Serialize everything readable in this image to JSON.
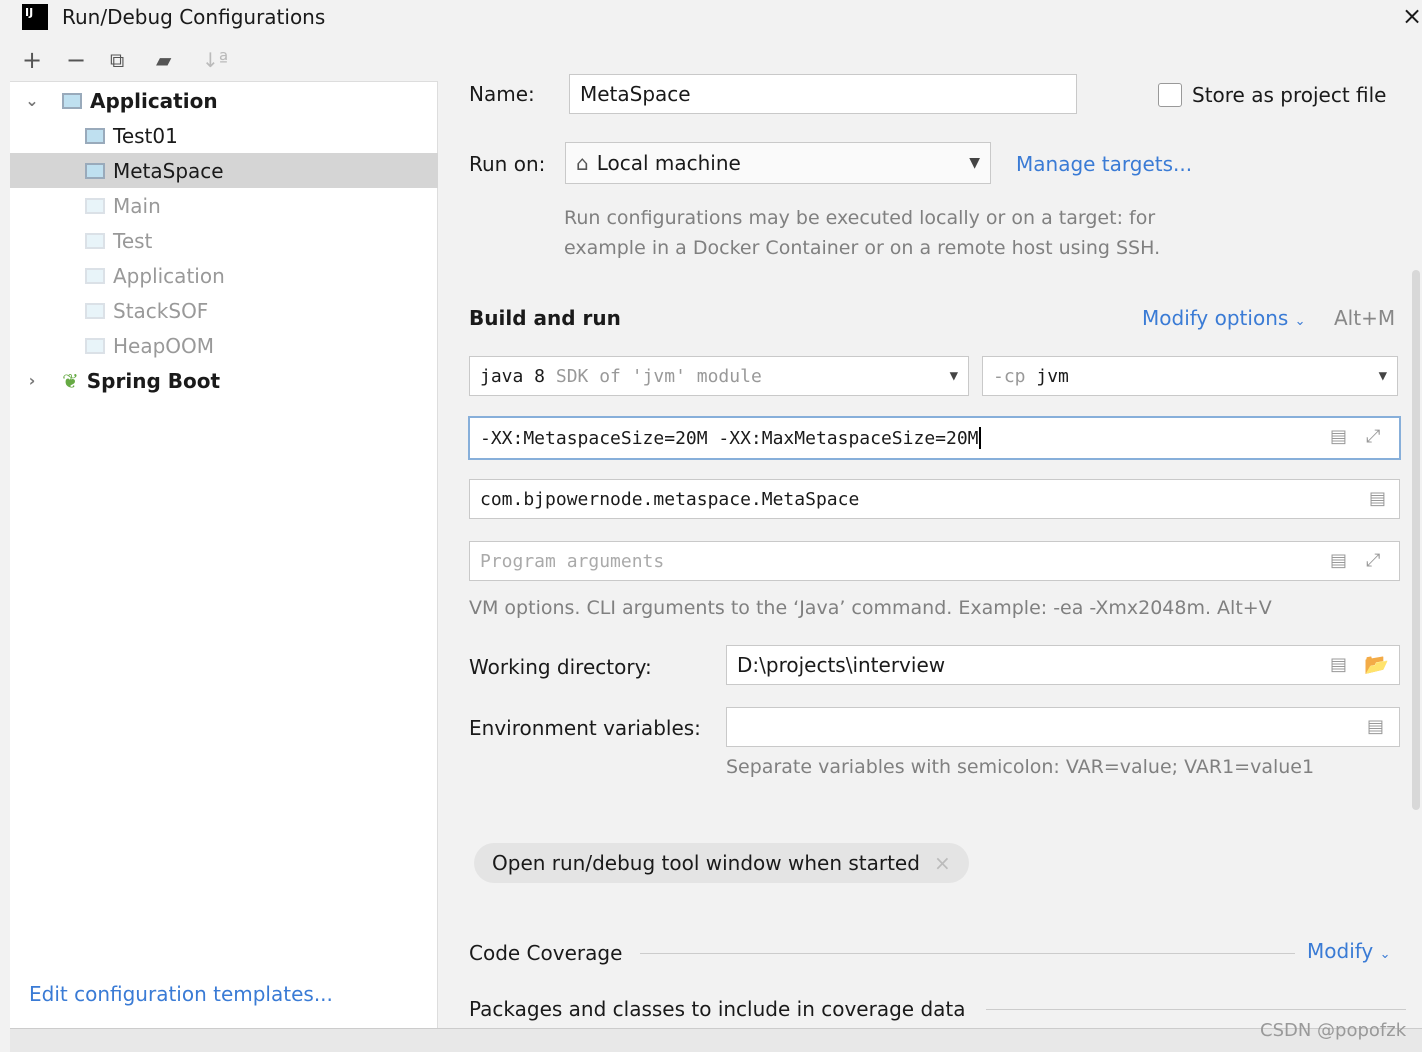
{
  "window": {
    "title": "Run/Debug Configurations",
    "logo": "IJ",
    "close_icon": "×"
  },
  "toolbar": {
    "add": "+",
    "remove": "−",
    "copy": "⧉",
    "folder": "▰",
    "sort": "↓ª"
  },
  "tree": {
    "groups": [
      {
        "label": "Application",
        "expanded": true,
        "items": [
          {
            "label": "Test01",
            "dim": false
          },
          {
            "label": "MetaSpace",
            "dim": false,
            "selected": true
          },
          {
            "label": "Main",
            "dim": true
          },
          {
            "label": "Test",
            "dim": true
          },
          {
            "label": "Application",
            "dim": true
          },
          {
            "label": "StackSOF",
            "dim": true
          },
          {
            "label": "HeapOOM",
            "dim": true
          }
        ]
      },
      {
        "label": "Spring Boot",
        "expanded": false
      }
    ]
  },
  "edit_templates": "Edit configuration templates...",
  "form": {
    "name_label": "Name:",
    "name_value": "MetaSpace",
    "store_label": "Store as project file",
    "run_on_label": "Run on:",
    "run_on_value": "Local machine",
    "manage_targets": "Manage targets...",
    "run_hint1": "Run configurations may be executed locally or on a target: for",
    "run_hint2": "example in a Docker Container or on a remote host using SSH.",
    "build_run": "Build and run",
    "modify_options": "Modify options",
    "modify_shortcut": "Alt+M",
    "sdk_main": "java 8",
    "sdk_sub": "SDK of 'jvm' module",
    "cp_prefix": "-cp",
    "cp_value": "jvm",
    "vm_options": "-XX:MetaspaceSize=20M -XX:MaxMetaspaceSize=20M",
    "main_class": "com.bjpowernode.metaspace.MetaSpace",
    "program_args_placeholder": "Program arguments",
    "vm_hint": "VM options. CLI arguments to the ‘Java’ command. Example: -ea -Xmx2048m. Alt+V",
    "workdir_label": "Working directory:",
    "workdir_value": "D:\\projects\\interview",
    "env_label": "Environment variables:",
    "env_value": "",
    "env_hint": "Separate variables with semicolon: VAR=value; VAR1=value1",
    "open_tool_window": "Open run/debug tool window when started",
    "code_coverage": "Code Coverage",
    "modify": "Modify",
    "packages_label": "Packages and classes to include in coverage data"
  },
  "watermark": "CSDN @popofzk",
  "colors": {
    "link": "#3a7bd5",
    "selected_row": "#d5d5d5",
    "focus_border": "#87afda"
  }
}
